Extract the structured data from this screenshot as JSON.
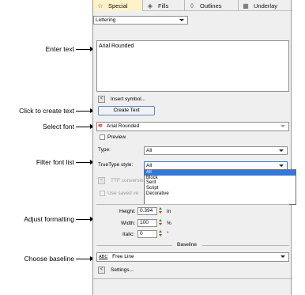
{
  "annotations": {
    "enter_text": "Enter text",
    "create_text": "Click to create text",
    "select_font": "Select font",
    "filter_font_list": "Filter font list",
    "adjust_formatting": "Adjust formatting",
    "choose_baseline": "Choose baseline"
  },
  "tabs": [
    {
      "label": "Special",
      "icon": "star-icon",
      "active": true
    },
    {
      "label": "Fills",
      "icon": "fill-icon"
    },
    {
      "label": "Outlines",
      "icon": "outline-icon"
    },
    {
      "label": "Underlay",
      "icon": "underlay-icon"
    }
  ],
  "object_type": "Lettering",
  "text_value": "Arial Rounded",
  "insert_symbol_label": "Insert symbol...",
  "create_text_label": "Create Text",
  "font_value": "Arial Rounded",
  "preview_label": "Preview",
  "type_label": "Type:",
  "type_value": "All",
  "truetype_label": "TrueType style:",
  "truetype_value": "All",
  "truetype_options": [
    "All",
    "Block",
    "Serif",
    "Script",
    "Decorative"
  ],
  "ttf_label": "TTF conversion",
  "use_saved_label": "Use saved ve",
  "height_label": "Height:",
  "height_value": "0.394",
  "height_unit": "in",
  "width_label": "Width:",
  "width_value": "100",
  "width_unit": "%",
  "italic_label": "Italic:",
  "italic_value": "0",
  "italic_unit": "°",
  "baseline_header": "Baseline",
  "baseline_value": "Free Line",
  "baseline_icon_text": "ABC",
  "settings_label": "Settings...",
  "colors": {
    "active_tab": "#fff2c8",
    "selection": "#3477d7",
    "focus_border": "#3478c6",
    "spin_up": "#2f8f3a",
    "spin_down": "#c8302a"
  }
}
